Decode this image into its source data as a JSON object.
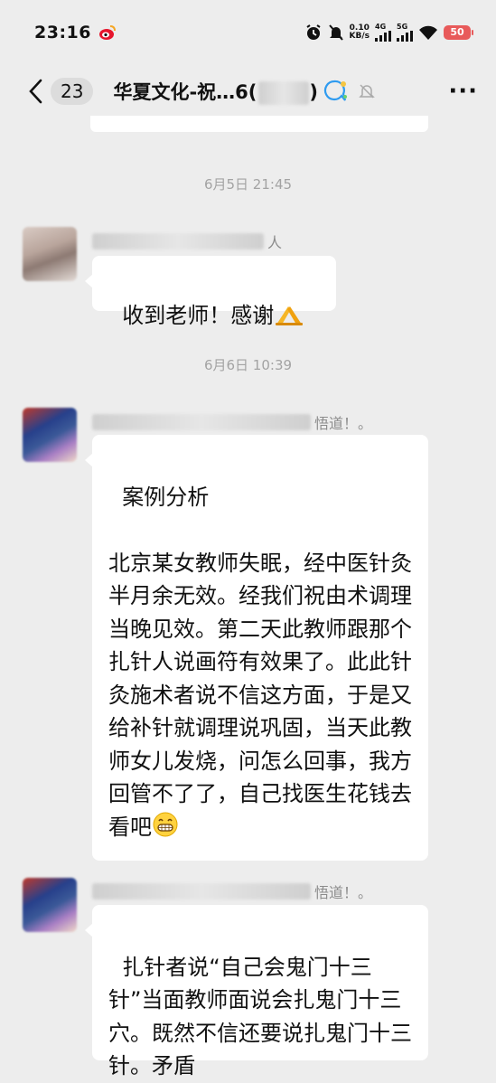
{
  "status_bar": {
    "time": "23:16",
    "net_speed_value": "0.10",
    "net_speed_unit": "KB/s",
    "sig1_label": "4G",
    "sig2_label": "5G",
    "battery": "50"
  },
  "header": {
    "unread_count": "23",
    "title": "华夏文化-祝…6(",
    "title_tail": ")",
    "more": "···"
  },
  "messages": {
    "ts1": "6月5日 21:45",
    "m1": {
      "sender_suffix": "人",
      "text": "收到老师！感谢"
    },
    "ts2": "6月6日 10:39",
    "m2": {
      "sender_suffix": "悟道！。",
      "text": "案例分析\n\n北京某女教师失眠，经中医针灸半月余无效。经我们祝由术调理当晚见效。第二天此教师跟那个扎针人说画符有效果了。此此针灸施术者说不信这方面，于是又给补针就调理说巩固，当天此教师女儿发烧，问怎么回事，我方回管不了了，自己找医生花钱去看吧"
    },
    "m3": {
      "sender_suffix": "悟道！。",
      "text": "扎针者说“自己会鬼门十三针”当面教师面说会扎鬼门十三穴。既然不信还要说扎鬼门十三针。矛盾"
    }
  },
  "colors": {
    "background": "#ededed",
    "bubble": "#ffffff",
    "timestamp": "#a3a3a3"
  },
  "icons": [
    "weibo-icon",
    "alarm-icon",
    "mute-icon",
    "wifi-icon",
    "back-icon",
    "ai-assistant-icon",
    "bell-off-icon",
    "pray-emoji",
    "grin-emoji"
  ]
}
